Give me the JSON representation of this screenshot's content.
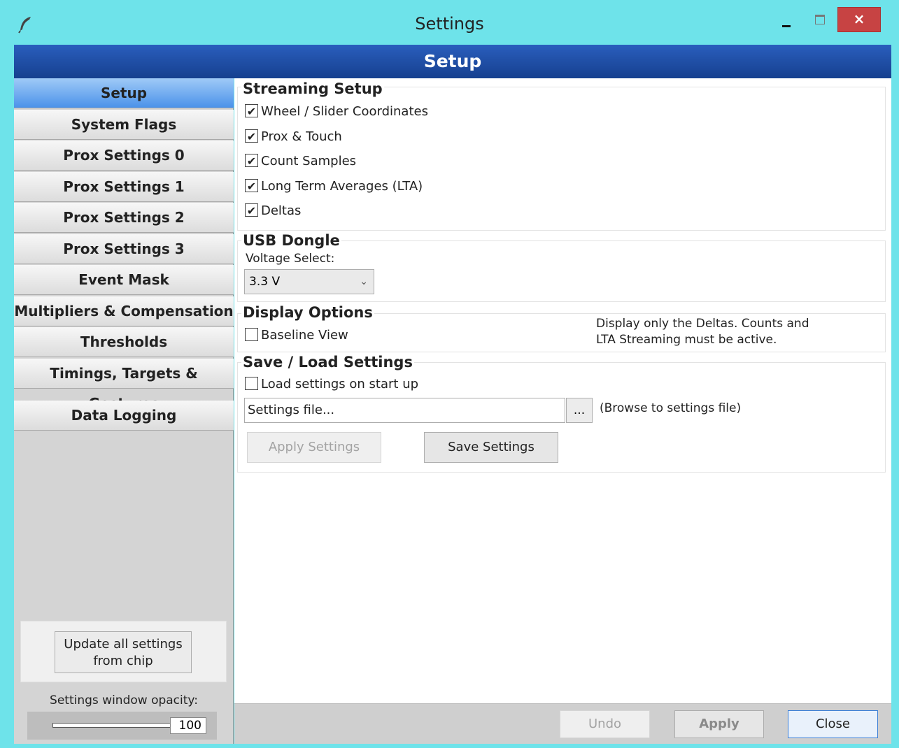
{
  "window": {
    "title": "Settings",
    "close_glyph": "×",
    "app_icon": "feather-icon",
    "accent_color": "#6ee3ea",
    "close_button_color": "#c74343"
  },
  "banner": {
    "title": "Setup",
    "color": "#1e4fa8"
  },
  "sidebar": {
    "items": [
      {
        "label": "Setup",
        "active": true
      },
      {
        "label": "System Flags"
      },
      {
        "label": "Prox Settings 0"
      },
      {
        "label": "Prox Settings 1"
      },
      {
        "label": "Prox Settings 2"
      },
      {
        "label": "Prox Settings 3"
      },
      {
        "label": "Event Mask"
      },
      {
        "label": "Multipliers & Compensation"
      },
      {
        "label": "Thresholds"
      },
      {
        "label": "Timings, Targets & Gestures"
      },
      {
        "label": "Data Logging"
      }
    ],
    "update_button": "Update all settings\nfrom chip",
    "update_line1": "Update all settings",
    "update_line2": "from chip",
    "opacity_label": "Settings window opacity:",
    "opacity_value": "100"
  },
  "streaming": {
    "title": "Streaming Setup",
    "options": [
      {
        "label": "Wheel / Slider Coordinates",
        "checked": true
      },
      {
        "label": "Prox & Touch",
        "checked": true
      },
      {
        "label": "Count Samples",
        "checked": true
      },
      {
        "label": "Long Term Averages (LTA)",
        "checked": true
      },
      {
        "label": "Deltas",
        "checked": true
      }
    ]
  },
  "usb": {
    "title": "USB Dongle",
    "voltage_label": "Voltage Select:",
    "voltage_value": "3.3 V"
  },
  "display": {
    "title": "Display Options",
    "baseline_label": "Baseline View",
    "note_line1": "Display only the Deltas. Counts and",
    "note_line2": "LTA Streaming must be active."
  },
  "saveload": {
    "title": "Save / Load Settings",
    "load_on_start_label": "Load settings on start up",
    "file_placeholder": "Settings file...",
    "browse_label": "...",
    "browse_hint": "(Browse to settings file)",
    "apply_label": "Apply Settings",
    "save_label": "Save Settings"
  },
  "footer": {
    "undo_label": "Undo",
    "apply_label": "Apply",
    "close_label": "Close"
  },
  "check_glyph": "✔"
}
